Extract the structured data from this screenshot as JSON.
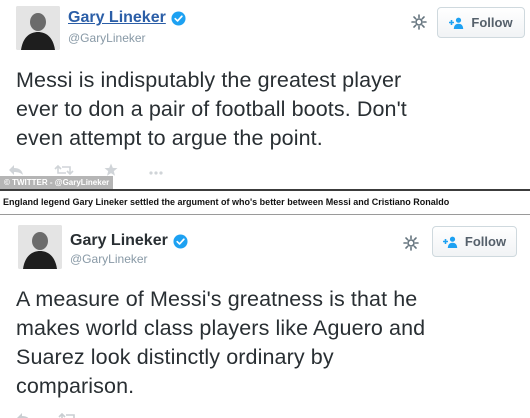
{
  "tweets": [
    {
      "display_name": "Gary Lineker",
      "handle": "@GaryLineker",
      "follow_label": "Follow",
      "text_lines": [
        "Messi is indisputably the greatest player",
        "ever to don a pair of football boots. Don't",
        "even attempt to argue the point."
      ],
      "watermark": "© TWITTER - @GaryLineker"
    },
    {
      "display_name": "Gary Lineker",
      "handle": "@GaryLineker",
      "follow_label": "Follow",
      "text_lines": [
        "A measure of Messi's greatness is that he",
        "makes world class players like Aguero and",
        "Suarez look distinctly ordinary by",
        "comparison."
      ]
    }
  ],
  "caption": "England legend Gary Lineker settled the argument of who's better between Messi and Cristiano Ronaldo",
  "icons": [
    "avatar",
    "verified-badge-icon",
    "gear-icon",
    "add-user-icon",
    "reply-icon",
    "retweet-icon",
    "favorite-icon",
    "more-icon"
  ],
  "colors": {
    "verified_blue": "#1da1f2",
    "link_blue": "#2b5ea7",
    "handle_grey": "#8899a6",
    "text": "#292f33"
  }
}
